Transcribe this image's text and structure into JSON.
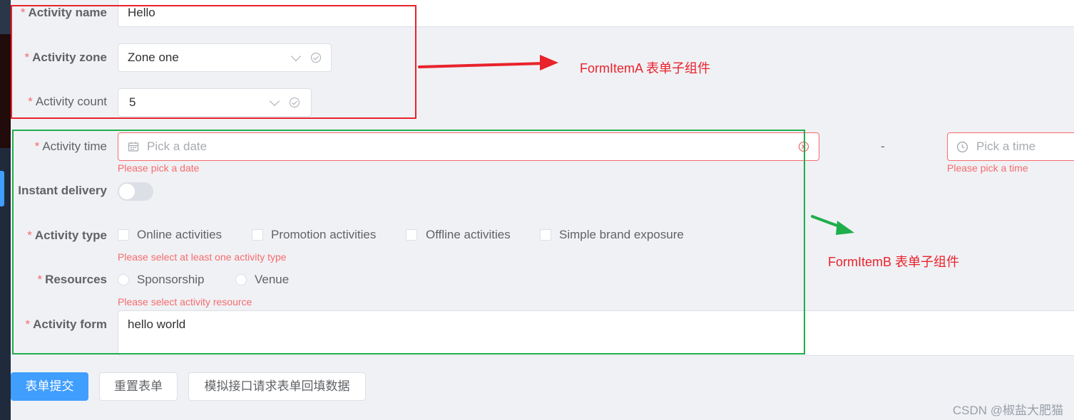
{
  "form": {
    "required_mark": "*",
    "activity_name": {
      "label": "Activity name",
      "value": "Hello"
    },
    "activity_zone": {
      "label": "Activity zone",
      "value": "Zone one"
    },
    "activity_count": {
      "label": "Activity count",
      "value": "5"
    },
    "activity_time": {
      "label": "Activity time",
      "date_placeholder": "Pick a date",
      "date_error": "Please pick a date",
      "separator": "-",
      "time_placeholder": "Pick a time",
      "time_error": "Please pick a time"
    },
    "instant_delivery": {
      "label": "Instant delivery",
      "on": false
    },
    "activity_type": {
      "label": "Activity type",
      "options": [
        "Online activities",
        "Promotion activities",
        "Offline activities",
        "Simple brand exposure"
      ],
      "error": "Please select at least one activity type"
    },
    "resources": {
      "label": "Resources",
      "options": [
        "Sponsorship",
        "Venue"
      ],
      "error": "Please select activity resource"
    },
    "activity_form": {
      "label": "Activity form",
      "value": "hello world"
    }
  },
  "buttons": {
    "submit": "表单提交",
    "reset": "重置表单",
    "mock": "模拟接口请求表单回填数据"
  },
  "annotations": {
    "a_label": "FormItemA 表单子组件",
    "b_label": "FormItemB 表单子组件",
    "a_color": "#e8232b",
    "b_color": "#1fae4b"
  },
  "watermark": "CSDN @椒盐大肥猫",
  "colors": {
    "primary": "#409eff",
    "danger": "#f56c6c"
  }
}
